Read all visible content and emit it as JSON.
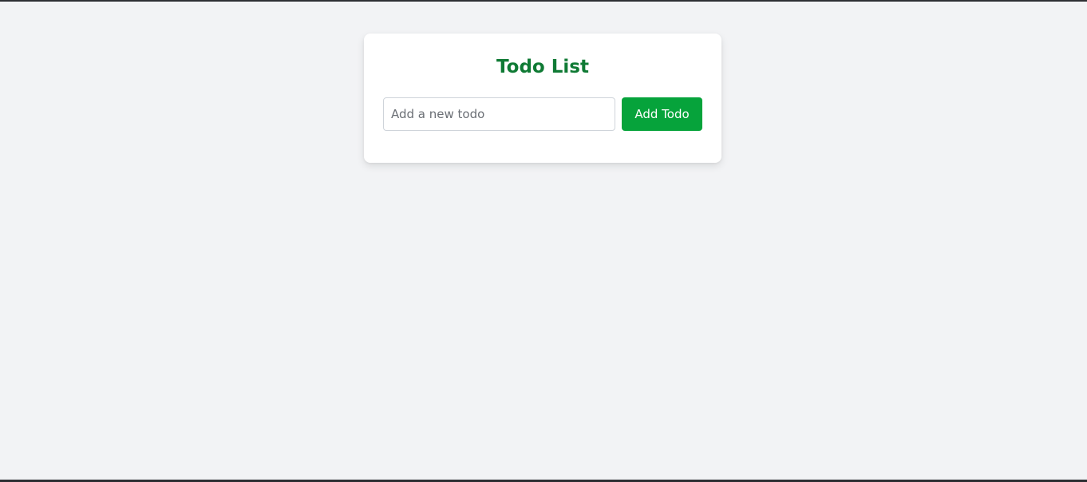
{
  "app": {
    "title": "Todo List"
  },
  "todo_form": {
    "input_value": "",
    "input_placeholder": "Add a new todo",
    "add_button_label": "Add Todo"
  },
  "colors": {
    "page_background": "#f2f3f5",
    "card_background": "#ffffff",
    "title_color": "#0f7a34",
    "button_color": "#06a33b",
    "button_text_color": "#ffffff"
  },
  "todos": []
}
